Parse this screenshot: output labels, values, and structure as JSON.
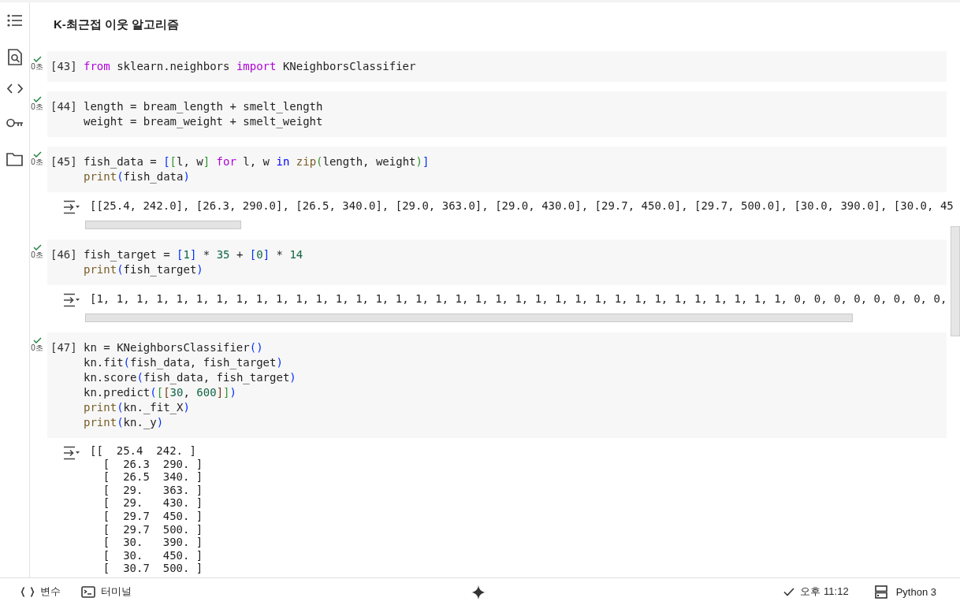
{
  "notebook": {
    "heading": "K-최근접 이웃 알고리즘",
    "cells": [
      {
        "count": "[43]",
        "done": true,
        "duration": "0초",
        "code": [
          [
            {
              "kind": "kw",
              "text": "from"
            },
            {
              "kind": "tx",
              "text": " sklearn.neighbors "
            },
            {
              "kind": "kw",
              "text": "import"
            },
            {
              "kind": "tx",
              "text": " KNeighborsClassifier"
            }
          ]
        ]
      },
      {
        "count": "[44]",
        "done": true,
        "duration": "0초",
        "code": [
          [
            {
              "kind": "tx",
              "text": "length = bream_length + smelt_length"
            }
          ],
          [
            {
              "kind": "tx",
              "text": "weight = bream_weight + smelt_weight"
            }
          ]
        ]
      },
      {
        "count": "[45]",
        "done": true,
        "duration": "0초",
        "code": [
          [
            {
              "kind": "tx",
              "text": "fish_data = "
            },
            {
              "kind": "b1",
              "text": "["
            },
            {
              "kind": "b2",
              "text": "["
            },
            {
              "kind": "tx",
              "text": "l, w"
            },
            {
              "kind": "b2",
              "text": "]"
            },
            {
              "kind": "kw",
              "text": " for"
            },
            {
              "kind": "tx",
              "text": " l, w "
            },
            {
              "kind": "op",
              "text": "in"
            },
            {
              "kind": "fn",
              "text": " zip"
            },
            {
              "kind": "b2",
              "text": "("
            },
            {
              "kind": "tx",
              "text": "length, weight"
            },
            {
              "kind": "b2",
              "text": ")"
            },
            {
              "kind": "b1",
              "text": "]"
            }
          ],
          [
            {
              "kind": "fn",
              "text": "print"
            },
            {
              "kind": "b1",
              "text": "("
            },
            {
              "kind": "tx",
              "text": "fish_data"
            },
            {
              "kind": "b1",
              "text": ")"
            }
          ]
        ],
        "output": {
          "kind": "wide",
          "lines": [
            "[[25.4, 242.0], [26.3, 290.0], [26.5, 340.0], [29.0, 363.0], [29.0, 430.0], [29.7, 450.0], [29.7, 500.0], [30.0, 390.0], [30.0, 45"
          ]
        }
      },
      {
        "count": "[46]",
        "done": true,
        "duration": "0초",
        "code": [
          [
            {
              "kind": "tx",
              "text": "fish_target = "
            },
            {
              "kind": "b1",
              "text": "["
            },
            {
              "kind": "num",
              "text": "1"
            },
            {
              "kind": "b1",
              "text": "]"
            },
            {
              "kind": "tx",
              "text": " * "
            },
            {
              "kind": "num",
              "text": "35"
            },
            {
              "kind": "tx",
              "text": " + "
            },
            {
              "kind": "b1",
              "text": "["
            },
            {
              "kind": "num",
              "text": "0"
            },
            {
              "kind": "b1",
              "text": "]"
            },
            {
              "kind": "tx",
              "text": " * "
            },
            {
              "kind": "num",
              "text": "14"
            }
          ],
          [
            {
              "kind": "fn",
              "text": "print"
            },
            {
              "kind": "b1",
              "text": "("
            },
            {
              "kind": "tx",
              "text": "fish_target"
            },
            {
              "kind": "b1",
              "text": ")"
            }
          ]
        ],
        "output": {
          "kind": "wide",
          "lines": [
            "[1, 1, 1, 1, 1, 1, 1, 1, 1, 1, 1, 1, 1, 1, 1, 1, 1, 1, 1, 1, 1, 1, 1, 1, 1, 1, 1, 1, 1, 1, 1, 1, 1, 1, 1, 0, 0, 0, 0, 0, 0, 0, 0,"
          ]
        }
      },
      {
        "count": "[47]",
        "done": true,
        "duration": "0초",
        "code": [
          [
            {
              "kind": "tx",
              "text": "kn = KNeighborsClassifier"
            },
            {
              "kind": "b1",
              "text": "()"
            }
          ],
          [
            {
              "kind": "tx",
              "text": "kn.fit"
            },
            {
              "kind": "b1",
              "text": "("
            },
            {
              "kind": "tx",
              "text": "fish_data, fish_target"
            },
            {
              "kind": "b1",
              "text": ")"
            }
          ],
          [
            {
              "kind": "tx",
              "text": "kn.score"
            },
            {
              "kind": "b1",
              "text": "("
            },
            {
              "kind": "tx",
              "text": "fish_data, fish_target"
            },
            {
              "kind": "b1",
              "text": ")"
            }
          ],
          [
            {
              "kind": "tx",
              "text": "kn.predict"
            },
            {
              "kind": "b1",
              "text": "("
            },
            {
              "kind": "b2",
              "text": "["
            },
            {
              "kind": "b3",
              "text": "["
            },
            {
              "kind": "num",
              "text": "30"
            },
            {
              "kind": "tx",
              "text": ", "
            },
            {
              "kind": "num",
              "text": "600"
            },
            {
              "kind": "b3",
              "text": "]"
            },
            {
              "kind": "b2",
              "text": "]"
            },
            {
              "kind": "b1",
              "text": ")"
            }
          ],
          [
            {
              "kind": "fn",
              "text": "print"
            },
            {
              "kind": "b1",
              "text": "("
            },
            {
              "kind": "tx",
              "text": "kn._fit_X"
            },
            {
              "kind": "b1",
              "text": ")"
            }
          ],
          [
            {
              "kind": "fn",
              "text": "print"
            },
            {
              "kind": "b1",
              "text": "("
            },
            {
              "kind": "tx",
              "text": "kn._y"
            },
            {
              "kind": "b1",
              "text": ")"
            }
          ]
        ],
        "output": {
          "kind": "block",
          "lines": [
            "[[  25.4  242. ]",
            "  [  26.3  290. ]",
            "  [  26.5  340. ]",
            "  [  29.   363. ]",
            "  [  29.   430. ]",
            "  [  29.7  450. ]",
            "  [  29.7  500. ]",
            "  [  30.   390. ]",
            "  [  30.   450. ]",
            "  [  30.7  500. ]"
          ]
        }
      }
    ]
  },
  "status_bar": {
    "left": [
      {
        "kind": "variables",
        "label": "변수"
      },
      {
        "kind": "terminal",
        "label": "터미널"
      }
    ],
    "time": "오후 11:12",
    "runtime": "Python 3"
  }
}
